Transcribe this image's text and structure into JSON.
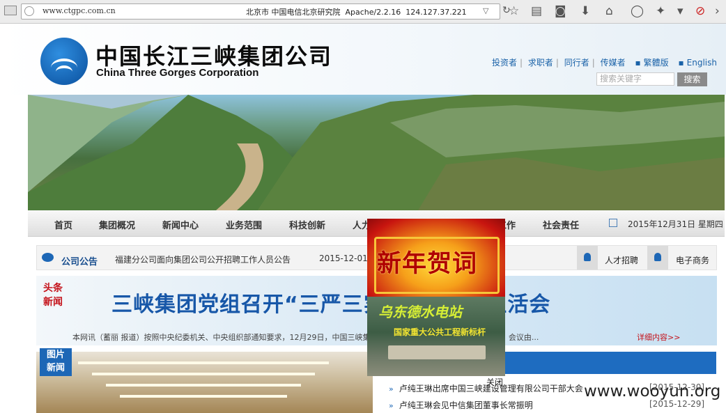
{
  "browser": {
    "url": "www.ctgpc.com.cn",
    "server_info": "北京市 中国电信北京研究院  Apache/2.2.16  124.127.37.221"
  },
  "header": {
    "logo_cn": "中国长江三峡集团公司",
    "logo_en": "China Three Gorges Corporation",
    "links": [
      "投资者",
      "求职者",
      "同行者",
      "传媒者"
    ],
    "lang_trad": "繁體版",
    "lang_en": "English",
    "search_placeholder": "搜索关键字",
    "search_button": "搜索"
  },
  "nav": {
    "items": [
      "首页",
      "集团概况",
      "新闻中心",
      "业务范围",
      "科技创新",
      "人力资源",
      "党群工作",
      "社会责任"
    ],
    "date": "2015年12月31日 星期四"
  },
  "notice": {
    "label": "公司公告",
    "text": "福建分公司面向集团公司公开招聘工作人员公告",
    "date": "2015-12-01",
    "quick_links": [
      "人才招聘",
      "电子商务"
    ]
  },
  "headline": {
    "tag_line1": "头条",
    "tag_line2": "新闻",
    "title": "三峡集团党组召开“三严三实”专题民主生活会",
    "summary": "本网讯（蓄丽 报道）按照中央纪委机关、中央组织部通知要求，12月29日，中国三峡集团党组召开“三严三实”专题民主生活会。会议由...",
    "more": "详细内容>>"
  },
  "photo_news": {
    "tag_line1": "图片",
    "tag_line2": "新闻"
  },
  "news_list": [
    {
      "title": "卢纯王琳出席中国三峡建设管理有限公司干部大会",
      "date": "[2015-12-30]"
    },
    {
      "title": "卢纯王琳会见中信集团董事长常振明",
      "date": "[2015-12-29]"
    }
  ],
  "popup": {
    "greeting": "新年贺词",
    "station": "乌东德水电站",
    "subtitle": "国家重大公共工程新标杆",
    "close": "关闭"
  },
  "watermark": "www.wooyun.org"
}
